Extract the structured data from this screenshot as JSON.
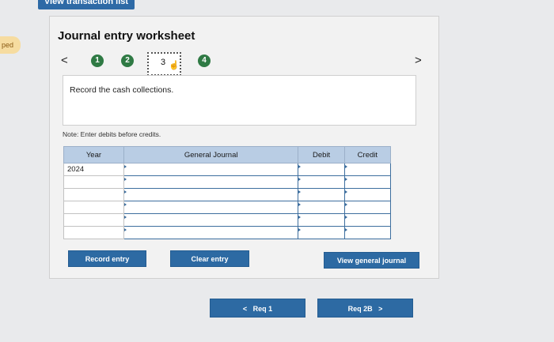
{
  "top_tab": {
    "label": "View transaction list"
  },
  "side_tab": {
    "label": "ped"
  },
  "worksheet": {
    "title": "Journal entry worksheet",
    "nav_prev": "<",
    "nav_next": ">",
    "steps": [
      "1",
      "2",
      "3",
      "4"
    ],
    "active_step": "3",
    "prompt": "Record the cash collections.",
    "note": "Note: Enter debits before credits.",
    "columns": [
      "Year",
      "General Journal",
      "Debit",
      "Credit"
    ],
    "rows": [
      {
        "year": "2024",
        "journal": "",
        "debit": "",
        "credit": ""
      },
      {
        "year": "",
        "journal": "",
        "debit": "",
        "credit": ""
      },
      {
        "year": "",
        "journal": "",
        "debit": "",
        "credit": ""
      },
      {
        "year": "",
        "journal": "",
        "debit": "",
        "credit": ""
      },
      {
        "year": "",
        "journal": "",
        "debit": "",
        "credit": ""
      },
      {
        "year": "",
        "journal": "",
        "debit": "",
        "credit": ""
      }
    ],
    "buttons": {
      "record": "Record entry",
      "clear": "Clear entry",
      "view": "View general journal"
    }
  },
  "footer_nav": {
    "prev": "Req 1",
    "next": "Req 2B"
  },
  "colors": {
    "accent": "#2d6aa3",
    "step_done": "#2f7a44",
    "header": "#b9cde4"
  }
}
